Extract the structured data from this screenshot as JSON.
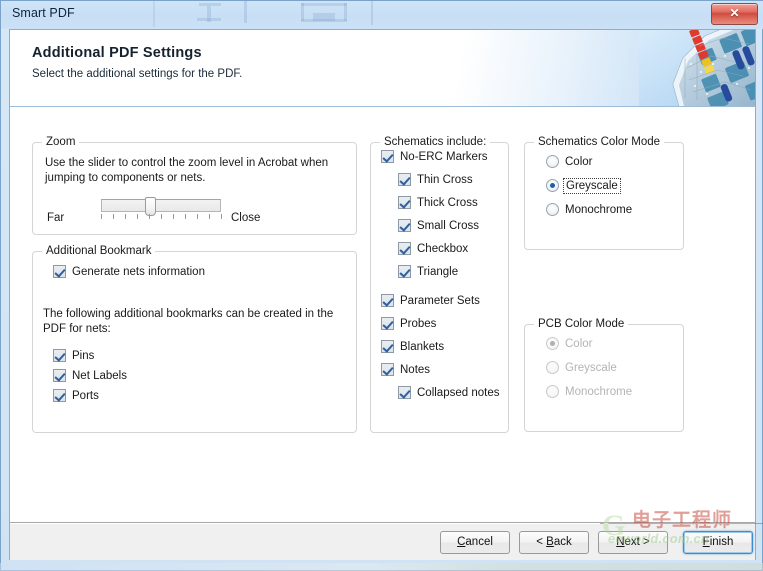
{
  "window": {
    "title": "Smart PDF",
    "close_label": "x"
  },
  "banner": {
    "title": "Additional PDF Settings",
    "subtitle": "Select the additional settings for the PDF."
  },
  "zoom_group": {
    "title": "Zoom",
    "description": "Use the slider to control the zoom level in Acrobat when jumping to components or nets.",
    "far_label": "Far",
    "close_label": "Close",
    "tick_count": 11,
    "value_percent": 40
  },
  "bookmark_group": {
    "title": "Additional Bookmark",
    "generate_nets": {
      "label": "Generate nets information",
      "checked": true
    },
    "description": "The following additional bookmarks can be created in the PDF for nets:",
    "items": [
      {
        "label": "Pins",
        "checked": true
      },
      {
        "label": "Net Labels",
        "checked": true
      },
      {
        "label": "Ports",
        "checked": true
      }
    ]
  },
  "schematics_group": {
    "title": "Schematics include:",
    "items": [
      {
        "label": "No-ERC Markers",
        "checked": true,
        "indent": 0
      },
      {
        "label": "Thin Cross",
        "checked": true,
        "indent": 1
      },
      {
        "label": "Thick Cross",
        "checked": true,
        "indent": 1
      },
      {
        "label": "Small Cross",
        "checked": true,
        "indent": 1
      },
      {
        "label": "Checkbox",
        "checked": true,
        "indent": 1
      },
      {
        "label": "Triangle",
        "checked": true,
        "indent": 1
      },
      {
        "label": "Parameter Sets",
        "checked": true,
        "indent": 0
      },
      {
        "label": "Probes",
        "checked": true,
        "indent": 0
      },
      {
        "label": "Blankets",
        "checked": true,
        "indent": 0
      },
      {
        "label": "Notes",
        "checked": true,
        "indent": 0
      },
      {
        "label": "Collapsed notes",
        "checked": true,
        "indent": 1
      }
    ]
  },
  "schematics_color_group": {
    "title": "Schematics Color Mode",
    "enabled": true,
    "selected": "Greyscale",
    "options": [
      {
        "label": "Color",
        "selected": false,
        "focused": false
      },
      {
        "label": "Greyscale",
        "selected": true,
        "focused": true
      },
      {
        "label": "Monochrome",
        "selected": false,
        "focused": false
      }
    ]
  },
  "pcb_color_group": {
    "title": "PCB Color Mode",
    "enabled": false,
    "selected": "Color",
    "options": [
      {
        "label": "Color",
        "selected": true,
        "focused": false
      },
      {
        "label": "Greyscale",
        "selected": false,
        "focused": false
      },
      {
        "label": "Monochrome",
        "selected": false,
        "focused": false
      }
    ]
  },
  "footer": {
    "buttons": [
      {
        "name": "cancel",
        "pre": "",
        "accel": "C",
        "post": "ancel",
        "focused": false
      },
      {
        "name": "back",
        "pre": "< ",
        "accel": "B",
        "post": "ack",
        "focused": false
      },
      {
        "name": "next",
        "pre": "",
        "accel": "N",
        "post": "ext >",
        "focused": false
      },
      {
        "name": "finish",
        "pre": "",
        "accel": "F",
        "post": "inish",
        "focused": true
      }
    ]
  },
  "watermark": {
    "logo": "G",
    "red_text": "电子工程师",
    "site": "eeworld.com.cn"
  },
  "colors": {
    "titlebar": "#cbe1f6",
    "accent_blue": "#1f5fa8",
    "focus_blue": "#3c8ad0",
    "close_red": "#cf4a3c",
    "group_border": "#d5d5d5",
    "disabled_text": "#b4b4b4"
  }
}
